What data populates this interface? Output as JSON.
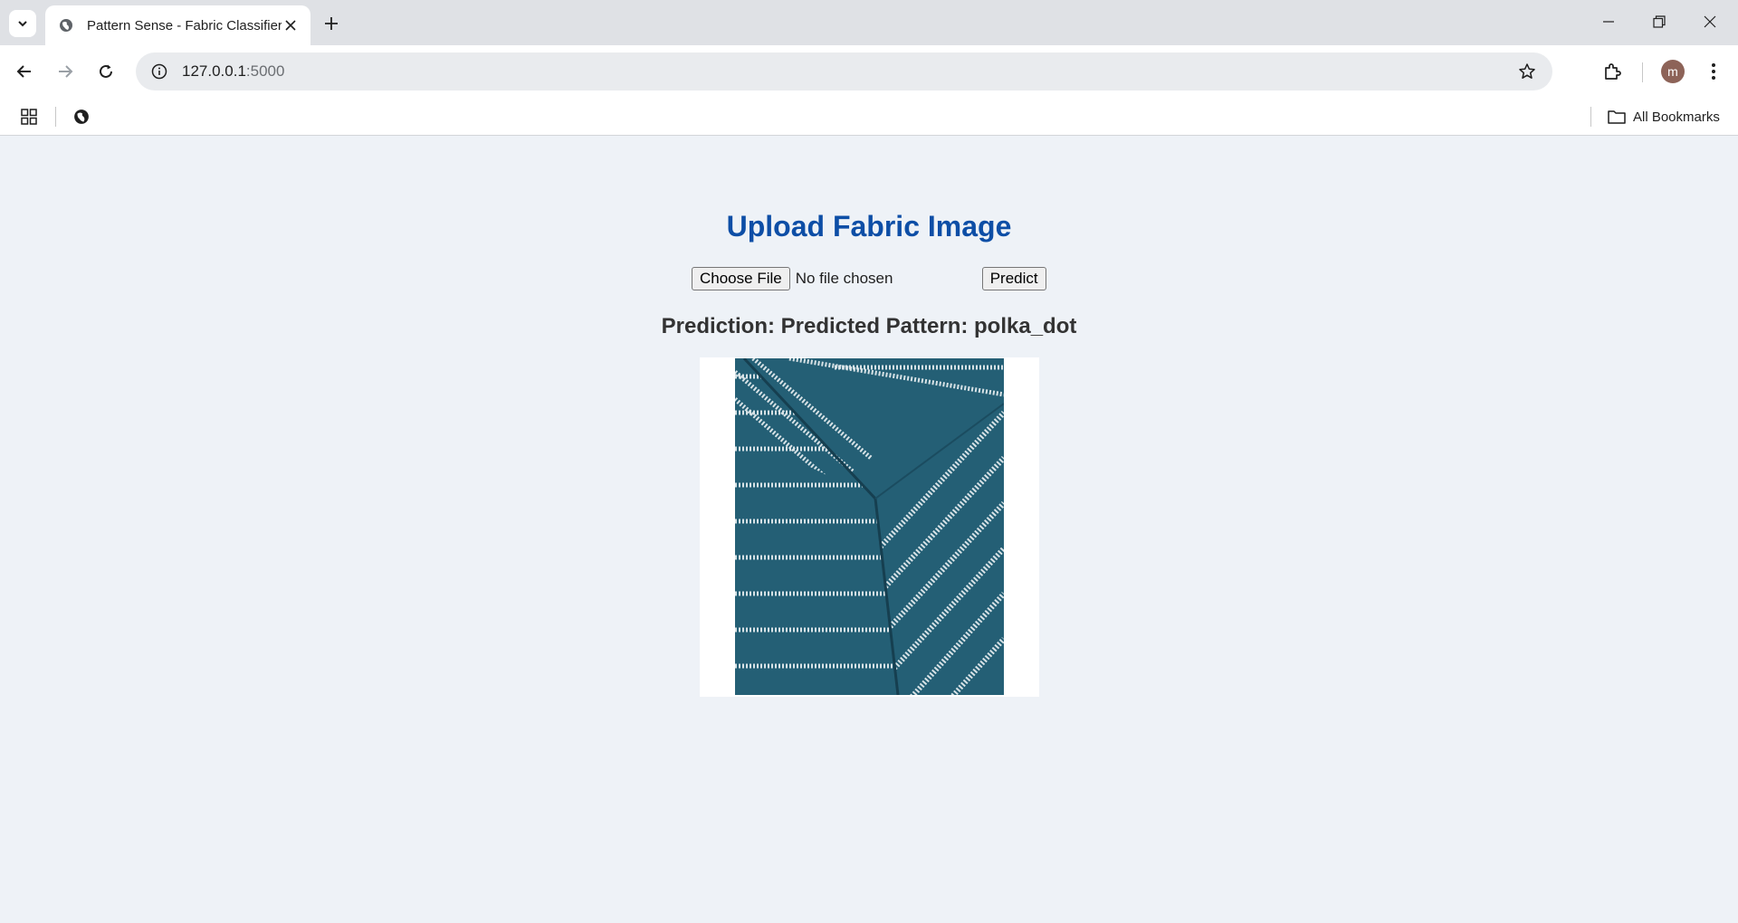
{
  "browser": {
    "tab": {
      "title": "Pattern Sense - Fabric Classifier"
    },
    "url": {
      "host": "127.0.0.1",
      "port": ":5000"
    },
    "profile_initial": "m",
    "bookmarks": {
      "all_label": "All Bookmarks"
    }
  },
  "page": {
    "heading": "Upload Fabric Image",
    "file_button_label": "Choose File",
    "file_status": "No file chosen",
    "predict_button_label": "Predict",
    "prediction_text": "Prediction: Predicted Pattern: polka_dot"
  },
  "colors": {
    "heading": "#0d4ea6",
    "page_background": "#eef2f7",
    "fabric_base": "#245f75",
    "fabric_stripe": "#d7e2e6"
  },
  "icons": [
    "tab-search-icon",
    "globe-icon",
    "close-icon",
    "plus-icon",
    "minimize-icon",
    "restore-icon",
    "back-icon",
    "forward-icon",
    "reload-icon",
    "info-icon",
    "star-icon",
    "extensions-icon",
    "kebab-menu-icon",
    "apps-grid-icon",
    "folder-icon"
  ]
}
